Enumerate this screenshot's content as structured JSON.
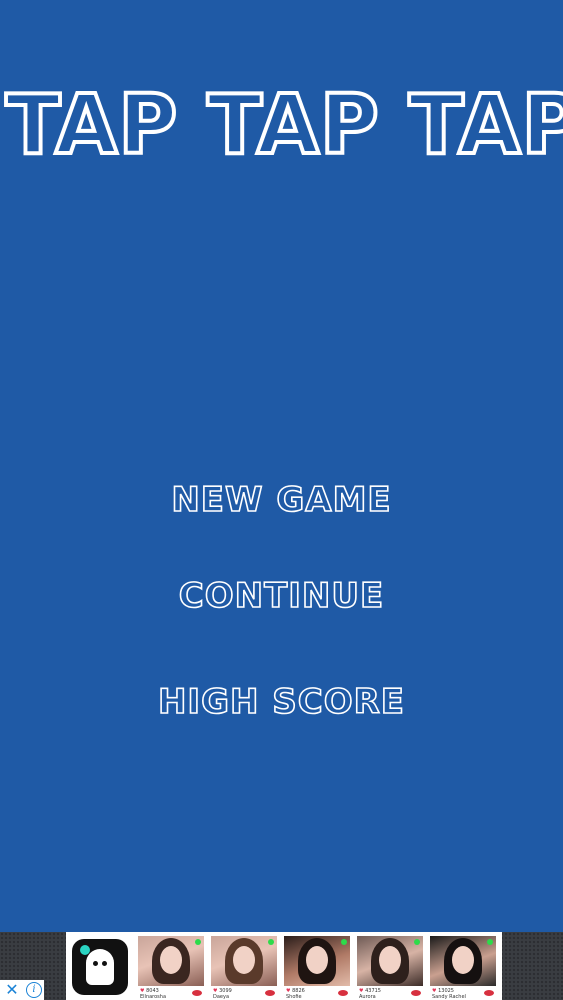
{
  "app": {
    "title": "TAP TAP TAP"
  },
  "menu": {
    "new_game": "NEW GAME",
    "continue": "CONTINUE",
    "high_score": "HIGH SCORE"
  },
  "ad": {
    "close_glyph": "✕",
    "info_glyph": "i",
    "profiles": [
      {
        "count": "8043",
        "name": "Ellnarosha"
      },
      {
        "count": "3099",
        "name": "Daeya"
      },
      {
        "count": "8826",
        "name": "Shofie"
      },
      {
        "count": "43715",
        "name": "Aurora"
      },
      {
        "count": "13025",
        "name": "Sandy Rachel"
      }
    ]
  },
  "colors": {
    "background": "#1f5aa6",
    "text_outline": "#ffffff",
    "ad_bar": "#3a3d42"
  }
}
